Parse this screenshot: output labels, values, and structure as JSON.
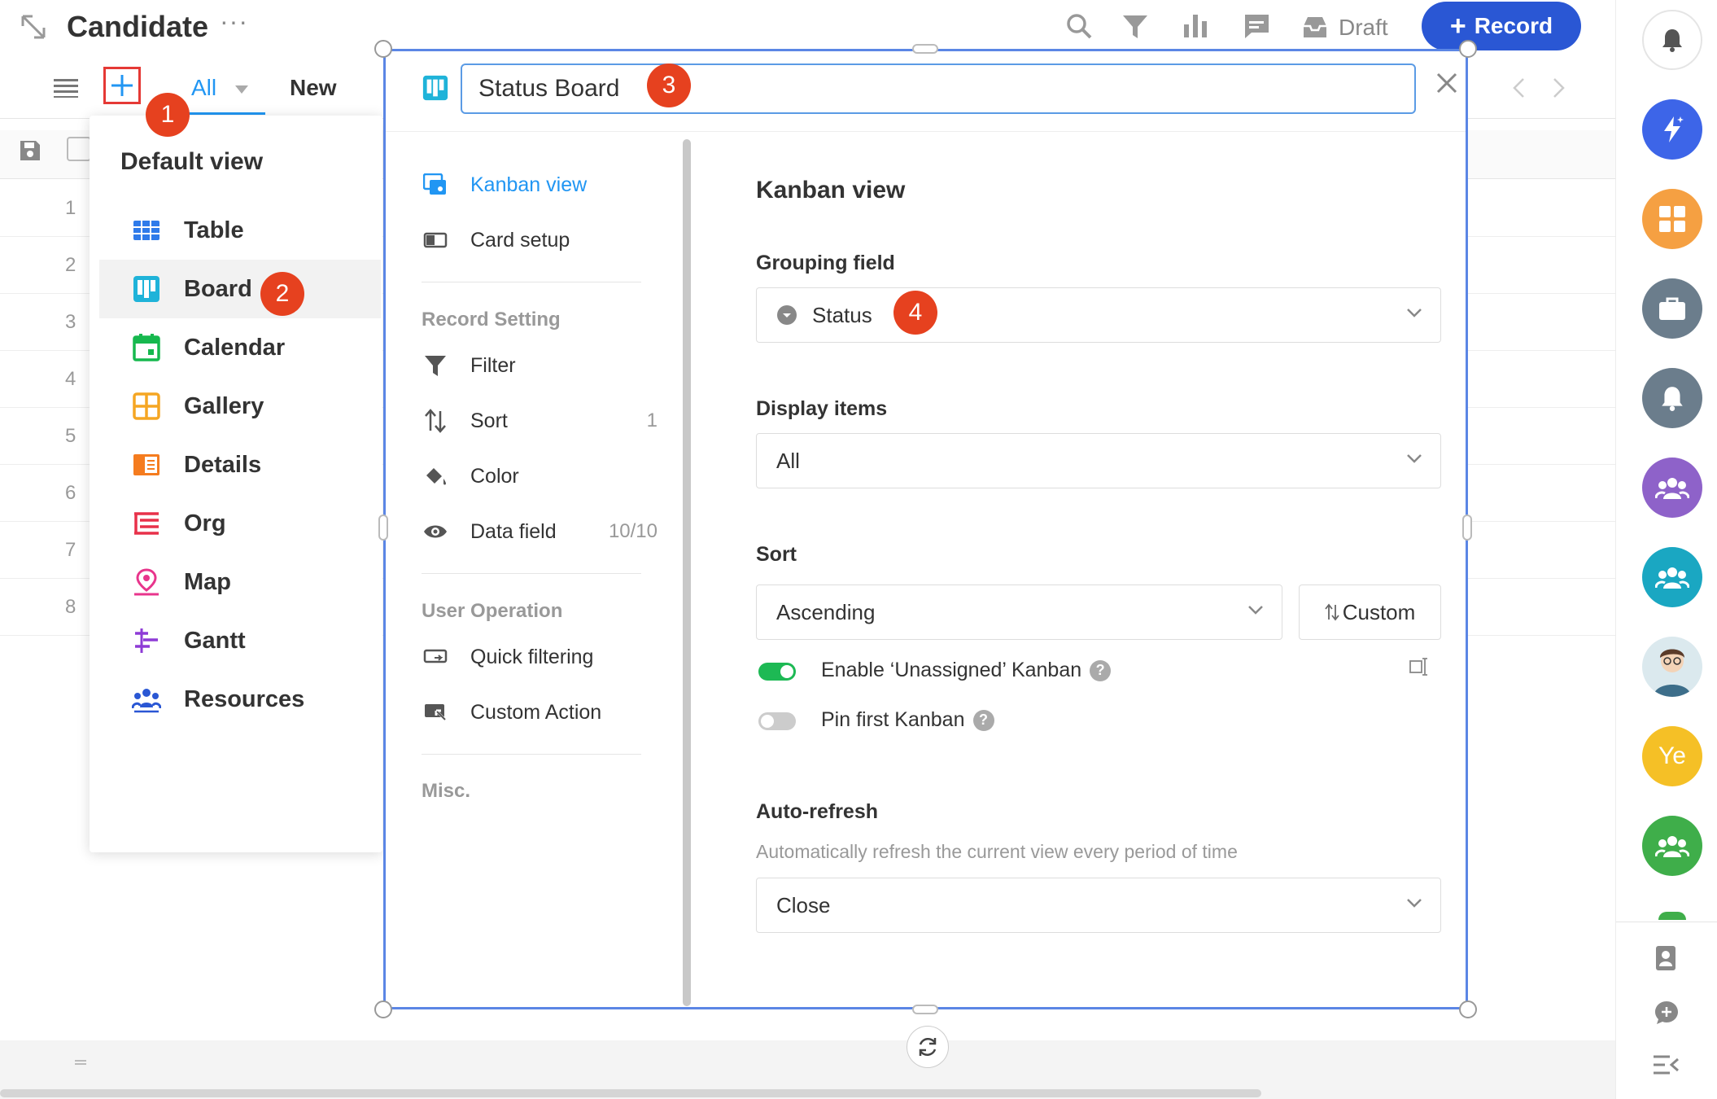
{
  "header": {
    "title": "Candidate",
    "more": "···",
    "draft_label": "Draft",
    "record_label": "Record"
  },
  "view_tabs": {
    "all_label": "All",
    "new_label": "New"
  },
  "grid": {
    "row_numbers": [
      "1",
      "2",
      "3",
      "4",
      "5",
      "6",
      "7",
      "8"
    ]
  },
  "view_menu": {
    "heading": "Default view",
    "items": [
      {
        "label": "Table",
        "icon": "table-icon"
      },
      {
        "label": "Board",
        "icon": "board-icon"
      },
      {
        "label": "Calendar",
        "icon": "calendar-icon"
      },
      {
        "label": "Gallery",
        "icon": "gallery-icon"
      },
      {
        "label": "Details",
        "icon": "details-icon"
      },
      {
        "label": "Org",
        "icon": "org-icon"
      },
      {
        "label": "Map",
        "icon": "map-pin-icon"
      },
      {
        "label": "Gantt",
        "icon": "gantt-icon"
      },
      {
        "label": "Resources",
        "icon": "resources-icon"
      }
    ],
    "selected": "Board"
  },
  "badges": [
    "1",
    "2",
    "3",
    "4"
  ],
  "modal": {
    "view_name": "Status Board",
    "nav": {
      "kanban_view": "Kanban view",
      "card_setup": "Card setup",
      "record_setting_section": "Record Setting",
      "filter": "Filter",
      "sort": "Sort",
      "sort_count": "1",
      "color": "Color",
      "data_field": "Data field",
      "data_field_count": "10/10",
      "user_operation_section": "User Operation",
      "quick_filtering": "Quick filtering",
      "custom_action": "Custom Action",
      "misc_section": "Misc."
    },
    "pane": {
      "title": "Kanban view",
      "grouping_label": "Grouping field",
      "grouping_value": "Status",
      "display_label": "Display items",
      "display_value": "All",
      "sort_label": "Sort",
      "sort_value": "Ascending",
      "custom_label": "Custom",
      "enable_unassigned_label": "Enable ‘Unassigned’ Kanban",
      "enable_unassigned_on": true,
      "pin_first_label": "Pin first Kanban",
      "pin_first_on": false,
      "auto_refresh_label": "Auto-refresh",
      "auto_refresh_desc": "Automatically refresh the current view every period of time",
      "auto_refresh_value": "Close"
    }
  },
  "right_rail": {
    "avatar_text": "Ye"
  },
  "colors": {
    "primary": "#2a57d4",
    "accent_blue": "#2196f3",
    "badge_red": "#e6411f",
    "toggle_green": "#1db954"
  }
}
